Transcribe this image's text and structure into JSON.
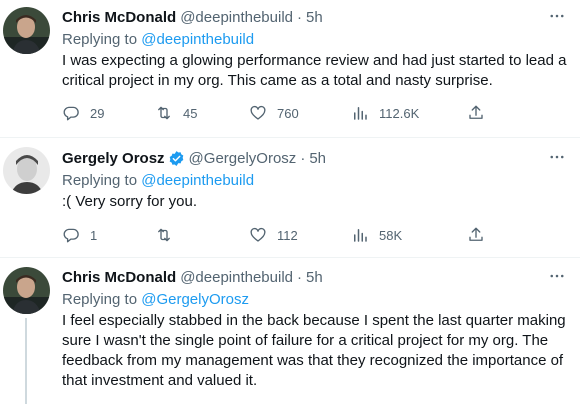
{
  "tweets": [
    {
      "name": "Chris McDonald",
      "handle": "@deepinthebuild",
      "dot": "·",
      "time": "5h",
      "verified": false,
      "replying_prefix": "Replying to",
      "replying_to": "@deepinthebuild",
      "text": "I was expecting a glowing performance review and had just started to lead a critical project in my org. This came as a total and nasty surprise.",
      "replies": "29",
      "retweets": "45",
      "likes": "760",
      "views": "112.6K"
    },
    {
      "name": "Gergely Orosz",
      "handle": "@GergelyOrosz",
      "dot": "·",
      "time": "5h",
      "verified": true,
      "replying_prefix": "Replying to",
      "replying_to": "@deepinthebuild",
      "text": ":( Very sorry for you.",
      "replies": "1",
      "retweets": "",
      "likes": "112",
      "views": "58K"
    },
    {
      "name": "Chris McDonald",
      "handle": "@deepinthebuild",
      "dot": "·",
      "time": "5h",
      "verified": false,
      "replying_prefix": "Replying to",
      "replying_to": "@GergelyOrosz",
      "text": "I feel especially stabbed in the back because I spent the last quarter making sure I wasn't the single point of failure for a critical project for my org. The feedback from my management was that they recognized the importance of that investment and valued it."
    }
  ],
  "colors": {
    "accent": "#1d9bf0",
    "secondary_text": "#536471",
    "primary_text": "#0f1419",
    "divider": "#eff3f4"
  }
}
